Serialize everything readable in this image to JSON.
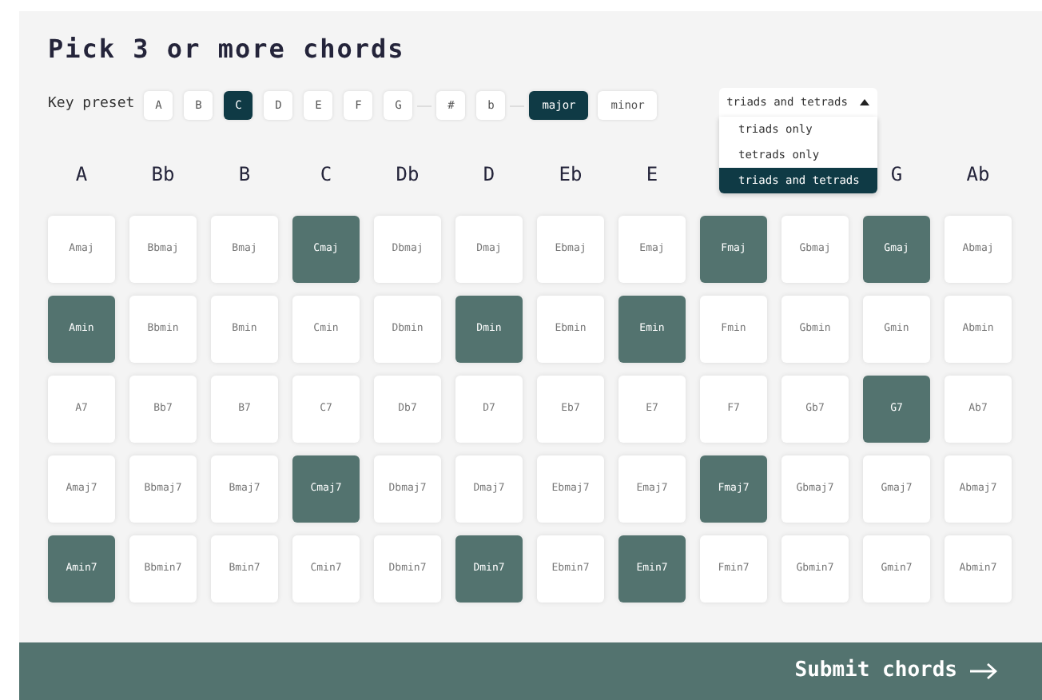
{
  "title": "Pick 3 or more chords",
  "key_preset": {
    "label": "Key preset",
    "notes": [
      {
        "label": "A",
        "selected": false
      },
      {
        "label": "B",
        "selected": false
      },
      {
        "label": "C",
        "selected": true
      },
      {
        "label": "D",
        "selected": false
      },
      {
        "label": "E",
        "selected": false
      },
      {
        "label": "F",
        "selected": false
      },
      {
        "label": "G",
        "selected": false
      }
    ],
    "accidentals": [
      {
        "label": "#",
        "selected": false
      },
      {
        "label": "b",
        "selected": false
      }
    ],
    "modes": [
      {
        "label": "major",
        "selected": true
      },
      {
        "label": "minor",
        "selected": false
      }
    ]
  },
  "chord_type_dropdown": {
    "value": "triads and tetrads",
    "expanded": true,
    "options": [
      {
        "label": "triads only",
        "selected": false
      },
      {
        "label": "tetrads only",
        "selected": false
      },
      {
        "label": "triads and tetrads",
        "selected": true
      }
    ]
  },
  "column_headers_left": [
    "A",
    "Bb",
    "B",
    "C",
    "Db",
    "D",
    "Eb",
    "E"
  ],
  "column_headers_right": [
    "G",
    "Ab"
  ],
  "chord_rows": [
    [
      {
        "name": "Amaj",
        "selected": false
      },
      {
        "name": "Bbmaj",
        "selected": false
      },
      {
        "name": "Bmaj",
        "selected": false
      },
      {
        "name": "Cmaj",
        "selected": true
      },
      {
        "name": "Dbmaj",
        "selected": false
      },
      {
        "name": "Dmaj",
        "selected": false
      },
      {
        "name": "Ebmaj",
        "selected": false
      },
      {
        "name": "Emaj",
        "selected": false
      },
      {
        "name": "Fmaj",
        "selected": true
      },
      {
        "name": "Gbmaj",
        "selected": false
      },
      {
        "name": "Gmaj",
        "selected": true
      },
      {
        "name": "Abmaj",
        "selected": false
      }
    ],
    [
      {
        "name": "Amin",
        "selected": true
      },
      {
        "name": "Bbmin",
        "selected": false
      },
      {
        "name": "Bmin",
        "selected": false
      },
      {
        "name": "Cmin",
        "selected": false
      },
      {
        "name": "Dbmin",
        "selected": false
      },
      {
        "name": "Dmin",
        "selected": true
      },
      {
        "name": "Ebmin",
        "selected": false
      },
      {
        "name": "Emin",
        "selected": true
      },
      {
        "name": "Fmin",
        "selected": false
      },
      {
        "name": "Gbmin",
        "selected": false
      },
      {
        "name": "Gmin",
        "selected": false
      },
      {
        "name": "Abmin",
        "selected": false
      }
    ],
    [
      {
        "name": "A7",
        "selected": false
      },
      {
        "name": "Bb7",
        "selected": false
      },
      {
        "name": "B7",
        "selected": false
      },
      {
        "name": "C7",
        "selected": false
      },
      {
        "name": "Db7",
        "selected": false
      },
      {
        "name": "D7",
        "selected": false
      },
      {
        "name": "Eb7",
        "selected": false
      },
      {
        "name": "E7",
        "selected": false
      },
      {
        "name": "F7",
        "selected": false
      },
      {
        "name": "Gb7",
        "selected": false
      },
      {
        "name": "G7",
        "selected": true
      },
      {
        "name": "Ab7",
        "selected": false
      }
    ],
    [
      {
        "name": "Amaj7",
        "selected": false
      },
      {
        "name": "Bbmaj7",
        "selected": false
      },
      {
        "name": "Bmaj7",
        "selected": false
      },
      {
        "name": "Cmaj7",
        "selected": true
      },
      {
        "name": "Dbmaj7",
        "selected": false
      },
      {
        "name": "Dmaj7",
        "selected": false
      },
      {
        "name": "Ebmaj7",
        "selected": false
      },
      {
        "name": "Emaj7",
        "selected": false
      },
      {
        "name": "Fmaj7",
        "selected": true
      },
      {
        "name": "Gbmaj7",
        "selected": false
      },
      {
        "name": "Gmaj7",
        "selected": false
      },
      {
        "name": "Abmaj7",
        "selected": false
      }
    ],
    [
      {
        "name": "Amin7",
        "selected": true
      },
      {
        "name": "Bbmin7",
        "selected": false
      },
      {
        "name": "Bmin7",
        "selected": false
      },
      {
        "name": "Cmin7",
        "selected": false
      },
      {
        "name": "Dbmin7",
        "selected": false
      },
      {
        "name": "Dmin7",
        "selected": true
      },
      {
        "name": "Ebmin7",
        "selected": false
      },
      {
        "name": "Emin7",
        "selected": true
      },
      {
        "name": "Fmin7",
        "selected": false
      },
      {
        "name": "Gbmin7",
        "selected": false
      },
      {
        "name": "Gmin7",
        "selected": false
      },
      {
        "name": "Abmin7",
        "selected": false
      }
    ]
  ],
  "submit_button": {
    "label": "Submit chords"
  }
}
